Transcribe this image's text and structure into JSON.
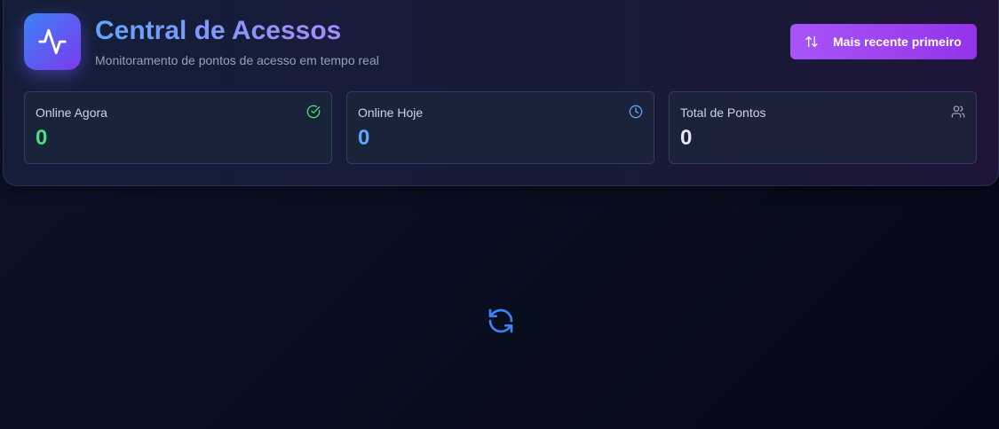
{
  "header": {
    "title": "Central de Acessos",
    "subtitle": "Monitoramento de pontos de acesso em tempo real",
    "logo_icon": "activity-icon",
    "sort_button": {
      "label": "Mais recente primeiro",
      "icon": "arrow-up-down-icon"
    }
  },
  "stats": [
    {
      "label": "Online Agora",
      "value": "0",
      "icon": "check-circle-icon",
      "color": "#4ade80"
    },
    {
      "label": "Online Hoje",
      "value": "0",
      "icon": "clock-icon",
      "color": "#60a5fa"
    },
    {
      "label": "Total de Pontos",
      "value": "0",
      "icon": "users-icon",
      "color": "#e2e8f0"
    }
  ],
  "main": {
    "loading_icon": "refresh-spinner-icon",
    "loading_color": "#3b82f6"
  },
  "colors": {
    "accent_start": "#60a5fa",
    "accent_end": "#a78bfa",
    "button": "#a855f7",
    "background": "#090e20"
  }
}
